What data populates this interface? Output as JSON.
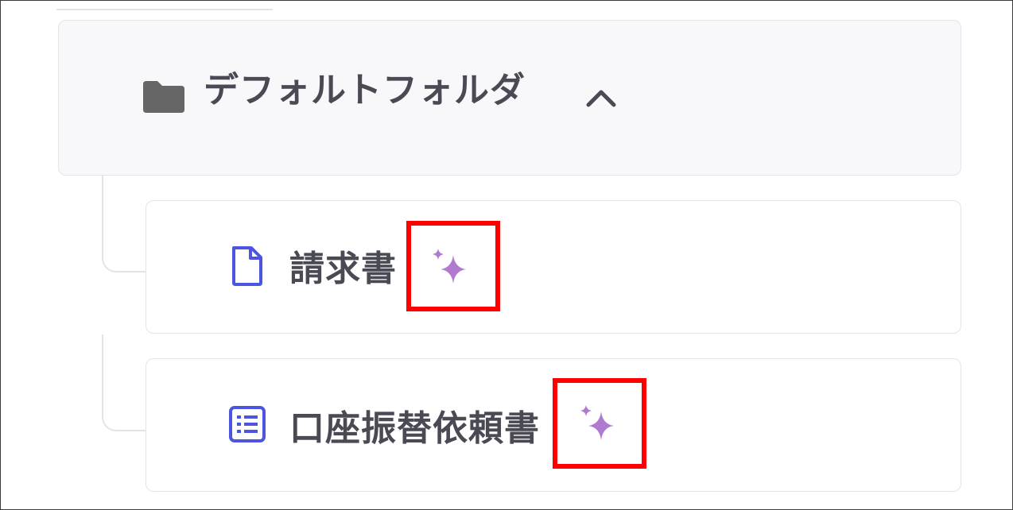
{
  "folder": {
    "title": "デフォルトフォルダ",
    "icon": "folder-icon",
    "toggle_icon": "chevron-up-icon",
    "expanded": true
  },
  "documents": [
    {
      "label": "請求書",
      "icon": "document-icon",
      "ai_icon": "sparkle-icon"
    },
    {
      "label": "口座振替依頼書",
      "icon": "list-icon",
      "ai_icon": "sparkle-icon"
    }
  ],
  "colors": {
    "accent_blue": "#4b55e0",
    "sparkle_purple": "#b07ad0",
    "highlight_red": "#ff0000",
    "text": "#4a4a55",
    "border": "#e3e3ec"
  }
}
